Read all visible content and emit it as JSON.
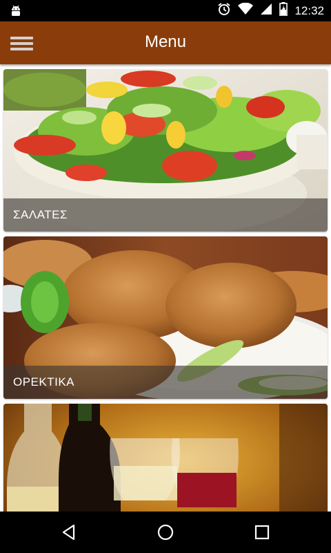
{
  "status_bar": {
    "time": "12:32",
    "icons": [
      "android-icon",
      "alarm-icon",
      "wifi-icon",
      "signal-icon",
      "battery-icon"
    ]
  },
  "app_bar": {
    "title": "Menu",
    "menu_icon": "hamburger-icon",
    "color": "#8a3d0a"
  },
  "categories": [
    {
      "label": "ΣΑΛΑΤΕΣ",
      "image": "salad-bowl-photo"
    },
    {
      "label": "ΟΡΕΚΤΙΚΑ",
      "image": "croquettes-photo"
    },
    {
      "label": "",
      "image": "wine-glasses-photo"
    }
  ],
  "nav_bar": {
    "buttons": [
      "back-icon",
      "home-icon",
      "recents-icon"
    ]
  }
}
